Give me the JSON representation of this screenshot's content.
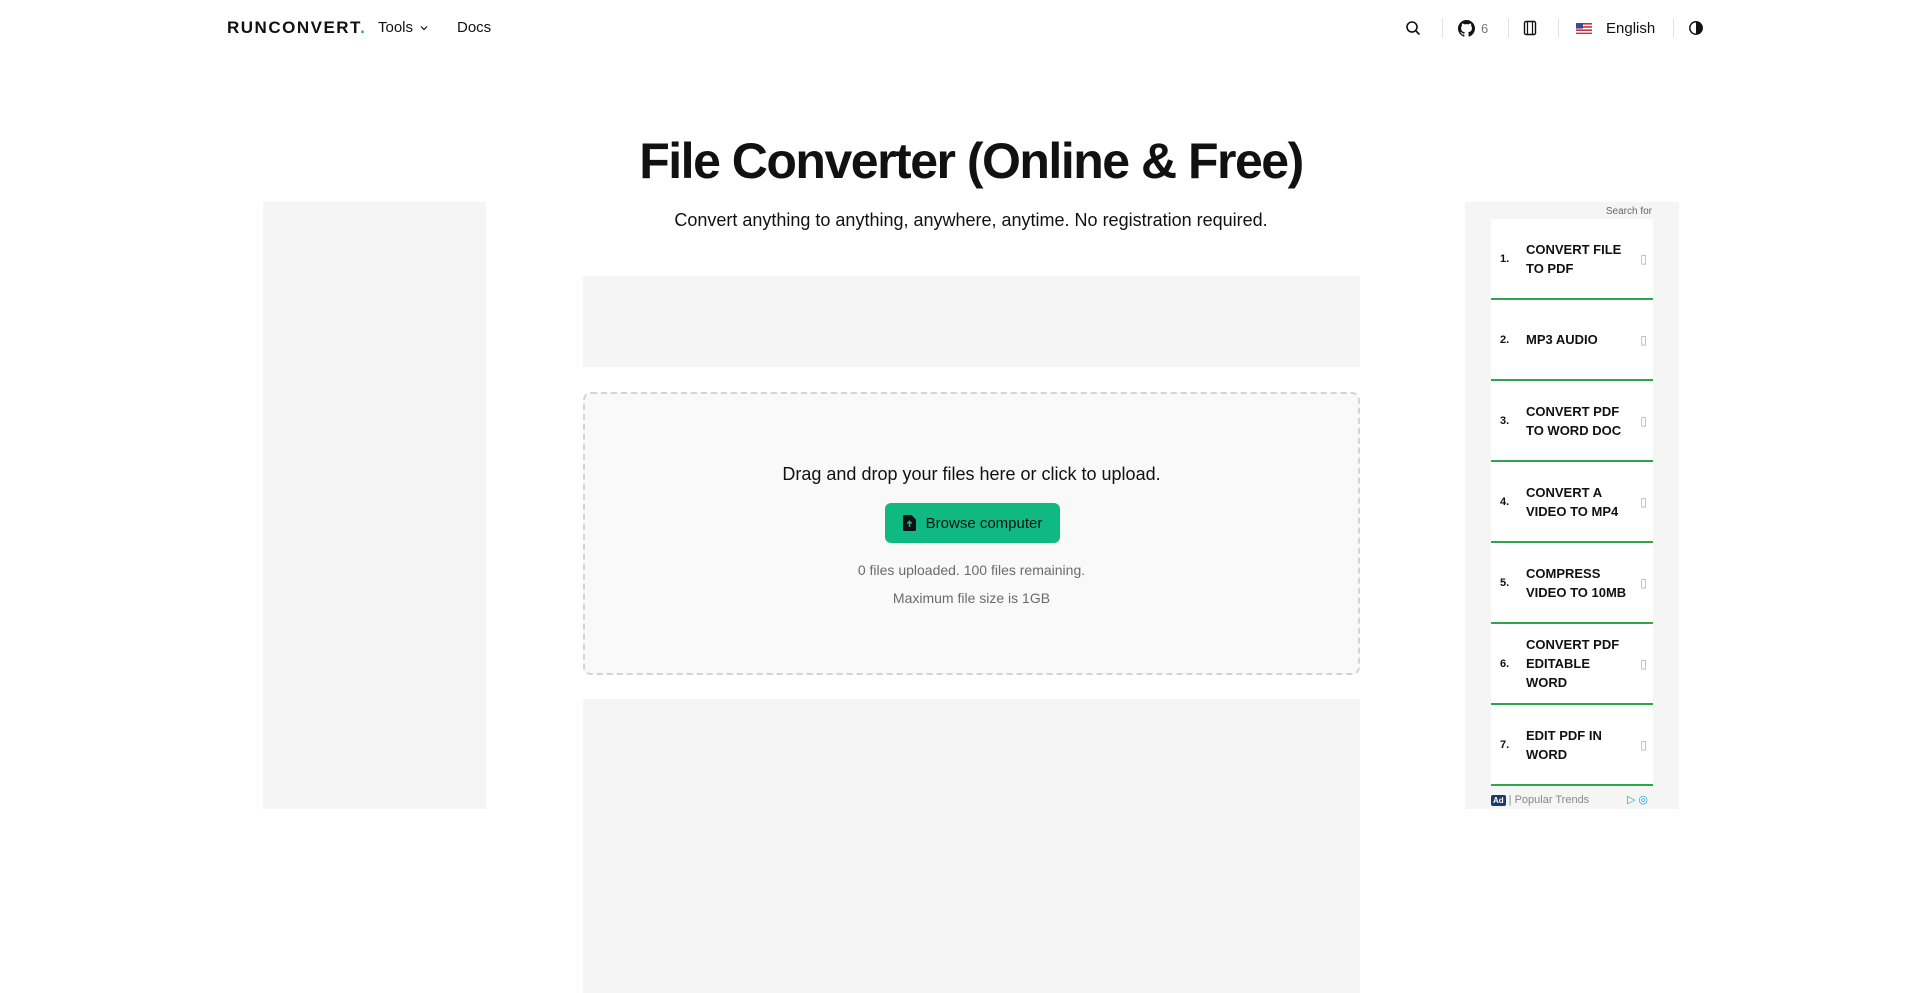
{
  "header": {
    "logo_text": "RUNCONVERT",
    "logo_dot": ".",
    "tools_label": "Tools",
    "docs_label": "Docs",
    "github_count": "6",
    "language": "English"
  },
  "hero": {
    "title": "File Converter (Online & Free)",
    "subtitle": "Convert anything to anything, anywhere, anytime. No registration required."
  },
  "upload": {
    "drop_text": "Drag and drop your files here or click to upload.",
    "browse_label": "Browse computer",
    "files_status": "0 files uploaded. 100 files remaining.",
    "max_size": "Maximum file size is 1GB"
  },
  "ad": {
    "search_for": "Search for",
    "items": [
      {
        "num": "1.",
        "label": "CONVERT FILE TO PDF"
      },
      {
        "num": "2.",
        "label": "MP3 AUDIO"
      },
      {
        "num": "3.",
        "label": "CONVERT PDF TO WORD DOC"
      },
      {
        "num": "4.",
        "label": "CONVERT A VIDEO TO MP4"
      },
      {
        "num": "5.",
        "label": "COMPRESS VIDEO TO 10MB"
      },
      {
        "num": "6.",
        "label": "CONVERT PDF EDITABLE WORD"
      },
      {
        "num": "7.",
        "label": "EDIT PDF IN WORD"
      }
    ],
    "badge": "Ad",
    "footer_text": "| Popular Trends"
  },
  "colors": {
    "accent": "#10b981",
    "ad_divider": "#2ea44f",
    "placeholder_bg": "#f5f5f5"
  },
  "icons": {
    "search": "search-icon",
    "github": "github-icon",
    "sidebar": "sidebar-toggle-icon",
    "flag": "us-flag-icon",
    "theme": "theme-toggle-icon",
    "file": "file-upload-icon"
  }
}
